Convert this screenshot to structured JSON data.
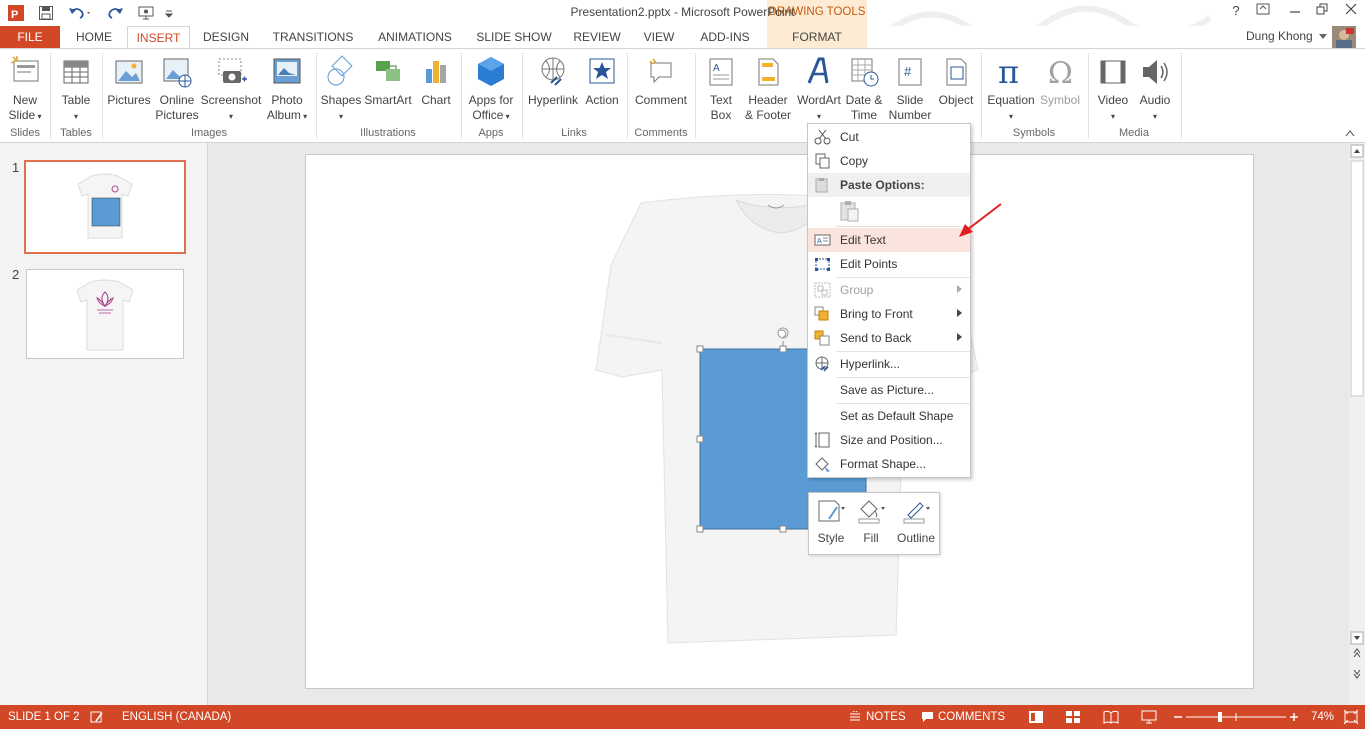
{
  "window": {
    "title": "Presentation2.pptx - Microsoft PowerPoint",
    "contextual_tab_group": "DRAWING TOOLS",
    "user": "Dung Khong",
    "help": "?"
  },
  "tabs": [
    {
      "label": "FILE"
    },
    {
      "label": "HOME"
    },
    {
      "label": "INSERT"
    },
    {
      "label": "DESIGN"
    },
    {
      "label": "TRANSITIONS"
    },
    {
      "label": "ANIMATIONS"
    },
    {
      "label": "SLIDE SHOW"
    },
    {
      "label": "REVIEW"
    },
    {
      "label": "VIEW"
    },
    {
      "label": "ADD-INS"
    },
    {
      "label": "FORMAT"
    }
  ],
  "active_tab": "INSERT",
  "ribbon": {
    "new_slide": [
      "New",
      "Slide"
    ],
    "table": "Table",
    "pictures": "Pictures",
    "online_pictures": [
      "Online",
      "Pictures"
    ],
    "screenshot": "Screenshot",
    "photo_album": [
      "Photo",
      "Album"
    ],
    "shapes": "Shapes",
    "smartart": "SmartArt",
    "chart": "Chart",
    "apps_for_office": [
      "Apps for",
      "Office"
    ],
    "hyperlink": "Hyperlink",
    "action": "Action",
    "comment": "Comment",
    "text_box": [
      "Text",
      "Box"
    ],
    "header_footer": [
      "Header",
      "& Footer"
    ],
    "wordart": "WordArt",
    "date_time": [
      "Date &",
      "Time"
    ],
    "slide_number": [
      "Slide",
      "Number"
    ],
    "object": "Object",
    "equation": "Equation",
    "symbol": "Symbol",
    "video": "Video",
    "audio": "Audio",
    "groups": {
      "slides": "Slides",
      "tables": "Tables",
      "images": "Images",
      "illustrations": "Illustrations",
      "apps": "Apps",
      "links": "Links",
      "comments": "Comments",
      "symbols": "Symbols",
      "media": "Media"
    }
  },
  "thumbnails": [
    {
      "number": "1",
      "selected": true
    },
    {
      "number": "2",
      "selected": false
    }
  ],
  "context_menu": {
    "cut": "Cut",
    "copy": "Copy",
    "paste_options": "Paste Options:",
    "edit_text": "Edit Text",
    "edit_points": "Edit Points",
    "group": "Group",
    "bring_to_front": "Bring to Front",
    "send_to_back": "Send to Back",
    "hyperlink": "Hyperlink...",
    "save_as_picture": "Save as Picture...",
    "set_default_shape": "Set as Default Shape",
    "size_position": "Size and Position...",
    "format_shape": "Format Shape..."
  },
  "mini_toolbar": {
    "style": "Style",
    "fill": "Fill",
    "outline": "Outline"
  },
  "status": {
    "slide": "SLIDE 1 OF 2",
    "language": "ENGLISH (CANADA)",
    "notes": "NOTES",
    "comments": "COMMENTS",
    "zoom": "74%"
  },
  "colors": {
    "accent": "#d24726",
    "shape_fill": "#5b9bd5",
    "highlight": "#fce4de",
    "contextual_tab": "#fdebd3"
  }
}
